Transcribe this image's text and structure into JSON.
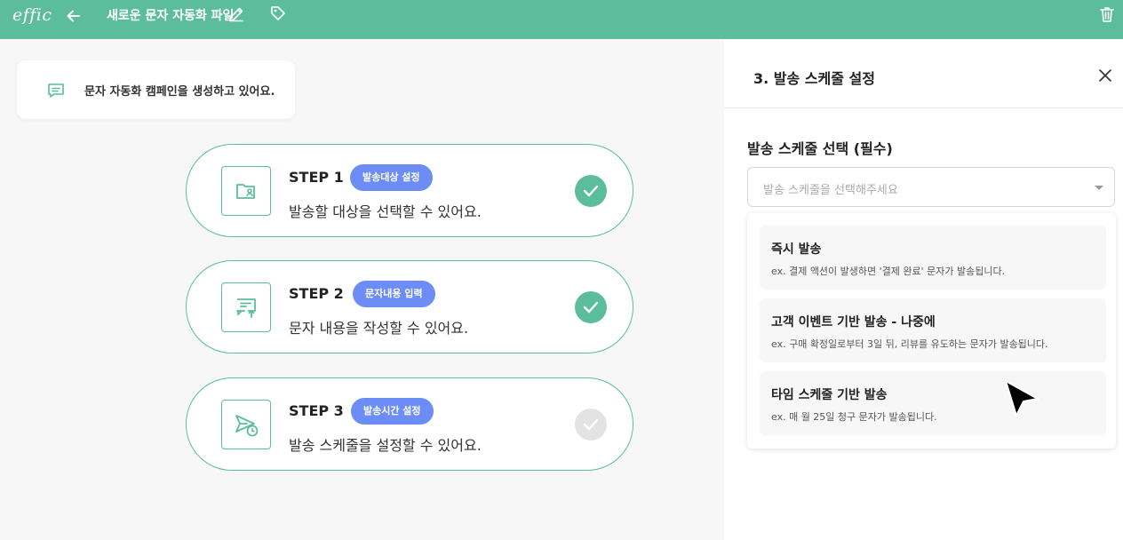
{
  "app": {
    "logo": "effic",
    "document_title": "새로운 문자 자동화 파일"
  },
  "icons": {
    "back": "arrow-left-icon",
    "edit": "pencil-icon",
    "tag": "tag-icon",
    "delete": "trash-icon"
  },
  "notice": {
    "text": "문자 자동화 캠페인을 생성하고 있어요."
  },
  "steps": [
    {
      "title": "STEP 1",
      "pill": "발송대상 설정",
      "description": "발송할 대상을 선택할 수 있어요.",
      "status": "done"
    },
    {
      "title": "STEP 2",
      "pill": "문자내용 입력",
      "description": "문자 내용을 작성할 수 있어요.",
      "status": "done"
    },
    {
      "title": "STEP 3",
      "pill": "발송시간 설정",
      "description": "발송 스케줄을 설정할 수 있어요.",
      "status": "pending"
    }
  ],
  "panel": {
    "title": "3. 발송 스케줄 설정",
    "section_label": "발송 스케줄 선택 (필수)",
    "select_placeholder": "발송 스케줄을 선택해주세요",
    "options": [
      {
        "title": "즉시 발송",
        "description": "ex. 결제 액션이 발생하면 '결제 완료' 문자가 발송됩니다."
      },
      {
        "title": "고객 이벤트 기반 발송 - 나중에",
        "description": "ex. 구매 확정일로부터 3일 뒤, 리뷰를 유도하는 문자가 발송됩니다."
      },
      {
        "title": "타임 스케줄 기반 발송",
        "description": "ex. 매 월 25일 청구 문자가 발송됩니다."
      }
    ]
  },
  "colors": {
    "brand": "#5bbd9c",
    "pill": "#6b8df5",
    "pending": "#e3e3e3"
  }
}
